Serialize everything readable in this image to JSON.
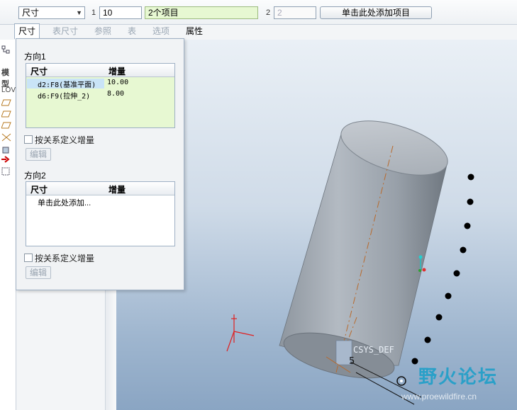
{
  "dashboard": {
    "type_select": "尺寸",
    "dir1_label": "1",
    "dir1_count": "10",
    "dir1_items": "2个项目",
    "dir2_label": "2",
    "dir2_count": "2",
    "dir2_add_button": "单击此处添加项目"
  },
  "tabs": [
    {
      "label": "尺寸"
    },
    {
      "label": "表尺寸"
    },
    {
      "label": "参照"
    },
    {
      "label": "表"
    },
    {
      "label": "选项"
    },
    {
      "label": "属性"
    }
  ],
  "tree": {
    "header": "模型",
    "root": "LOV"
  },
  "panel": {
    "direction1": {
      "title": "方向1",
      "col_dim": "尺寸",
      "col_inc": "增量",
      "rows": [
        {
          "dim": "d2:F8(基准平面)",
          "inc": "10.00"
        },
        {
          "dim": "d6:F9(拉伸_2)",
          "inc": "8.00"
        }
      ],
      "relation_checkbox": "按关系定义增量",
      "edit_button": "编辑"
    },
    "direction2": {
      "title": "方向2",
      "col_dim": "尺寸",
      "col_inc": "增量",
      "placeholder_row": "单击此处添加...",
      "relation_checkbox": "按关系定义增量",
      "edit_button": "编辑"
    }
  },
  "viewport": {
    "csys_label": "CSYS_DEF",
    "dim_label": "5"
  },
  "watermark": {
    "name": "野火论坛",
    "url": "www.proewildfire.cn"
  }
}
